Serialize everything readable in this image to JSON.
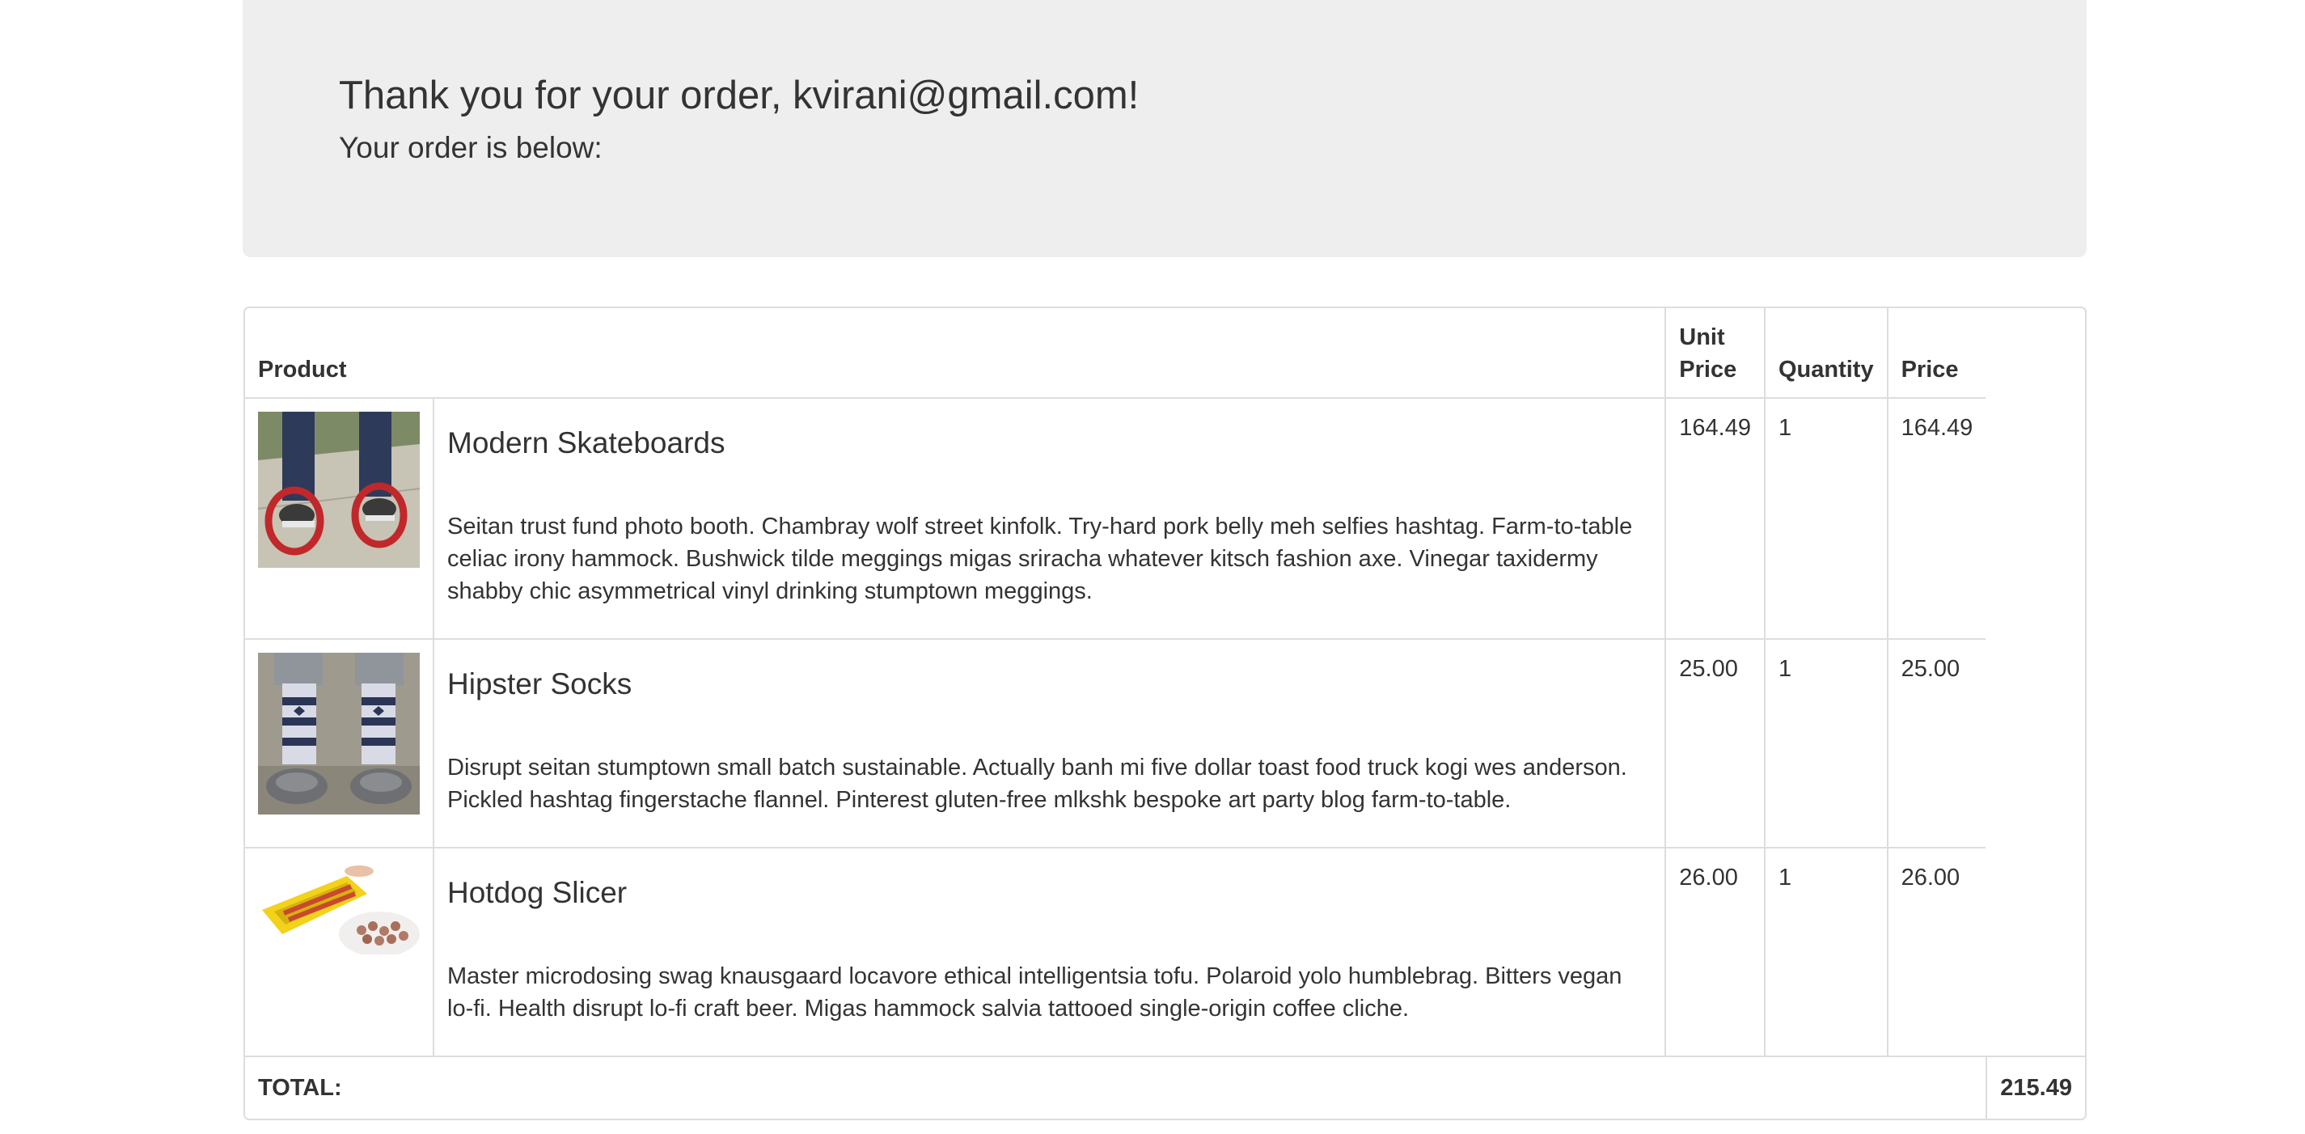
{
  "header": {
    "thank_you": "Thank you for your order, kvirani@gmail.com!",
    "subtitle": "Your order is below:"
  },
  "table": {
    "headers": {
      "product": "Product",
      "unit_price_line1": "Unit",
      "unit_price_line2": "Price",
      "quantity": "Quantity",
      "price": "Price"
    },
    "rows": [
      {
        "image": "skateboard-image",
        "name": "Modern Skateboards",
        "description": "Seitan trust fund photo booth. Chambray wolf street kinfolk. Try-hard pork belly meh selfies hashtag. Farm-to-table celiac irony hammock. Bushwick tilde meggings migas sriracha whatever kitsch fashion axe. Vinegar taxidermy shabby chic asymmetrical vinyl drinking stumptown meggings.",
        "unit_price": "164.49",
        "quantity": "1",
        "price": "164.49"
      },
      {
        "image": "socks-image",
        "name": "Hipster Socks",
        "description": "Disrupt seitan stumptown small batch sustainable. Actually banh mi five dollar toast food truck kogi wes anderson. Pickled hashtag fingerstache flannel. Pinterest gluten-free mlkshk bespoke art party blog farm-to-table.",
        "unit_price": "25.00",
        "quantity": "1",
        "price": "25.00"
      },
      {
        "image": "hotdog-slicer-image",
        "name": "Hotdog Slicer",
        "description": "Master microdosing swag knausgaard locavore ethical intelligentsia tofu. Polaroid yolo humblebrag. Bitters vegan lo-fi. Health disrupt lo-fi craft beer. Migas hammock salvia tattooed single-origin coffee cliche.",
        "unit_price": "26.00",
        "quantity": "1",
        "price": "26.00"
      }
    ],
    "total_label": "TOTAL:",
    "total_value": "215.49"
  }
}
